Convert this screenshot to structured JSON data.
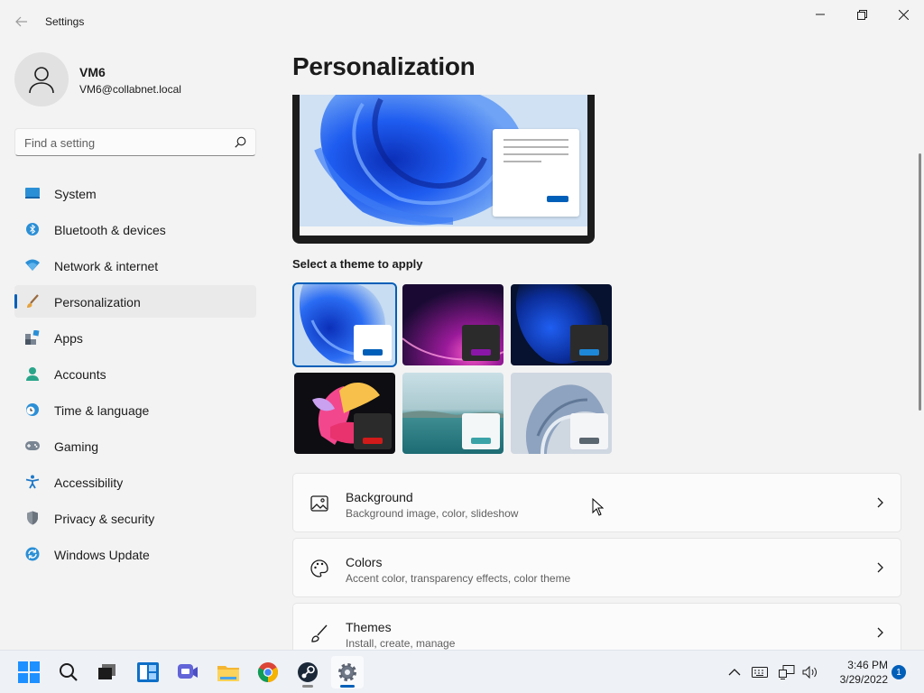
{
  "window": {
    "title": "Settings"
  },
  "user": {
    "name": "VM6",
    "email": "VM6@collabnet.local"
  },
  "search": {
    "placeholder": "Find a setting"
  },
  "sidebar": {
    "items": [
      {
        "label": "System",
        "icon": "system-icon"
      },
      {
        "label": "Bluetooth & devices",
        "icon": "bluetooth-icon"
      },
      {
        "label": "Network & internet",
        "icon": "wifi-icon"
      },
      {
        "label": "Personalization",
        "icon": "brush-icon",
        "active": true
      },
      {
        "label": "Apps",
        "icon": "apps-icon"
      },
      {
        "label": "Accounts",
        "icon": "accounts-icon"
      },
      {
        "label": "Time & language",
        "icon": "clock-globe-icon"
      },
      {
        "label": "Gaming",
        "icon": "gamepad-icon"
      },
      {
        "label": "Accessibility",
        "icon": "accessibility-icon"
      },
      {
        "label": "Privacy & security",
        "icon": "shield-icon"
      },
      {
        "label": "Windows Update",
        "icon": "update-icon"
      }
    ]
  },
  "main": {
    "title": "Personalization",
    "themes_label": "Select a theme to apply",
    "cards": [
      {
        "title": "Background",
        "subtitle": "Background image, color, slideshow",
        "icon": "image-icon"
      },
      {
        "title": "Colors",
        "subtitle": "Accent color, transparency effects, color theme",
        "icon": "palette-icon"
      },
      {
        "title": "Themes",
        "subtitle": "Install, create, manage",
        "icon": "brush-icon"
      }
    ]
  },
  "taskbar": {
    "time": "3:46 PM",
    "date": "3/29/2022",
    "notifications": "1"
  },
  "colors": {
    "accent": "#005fb8",
    "background": "#f3f3f3"
  }
}
